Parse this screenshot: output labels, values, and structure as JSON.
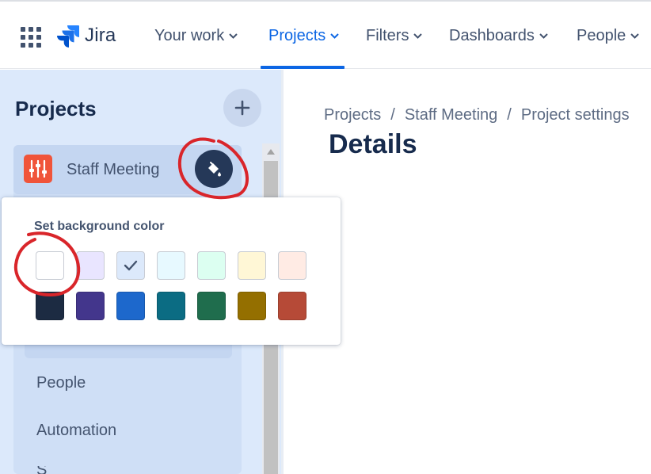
{
  "topnav": {
    "logo_text": "Jira",
    "items": [
      {
        "label": "Your work"
      },
      {
        "label": "Projects"
      },
      {
        "label": "Filters"
      },
      {
        "label": "Dashboards"
      },
      {
        "label": "People"
      }
    ],
    "active_item": "Projects",
    "accent_color": "#0c66e4"
  },
  "sidebar": {
    "title": "Projects",
    "add_icon": "plus-icon",
    "project": {
      "name": "Staff Meeting",
      "avatar_icon": "sliders-icon",
      "avatar_color": "#f0543a"
    },
    "change_bg_icon": "paint-bucket-icon",
    "links": [
      {
        "label": "People"
      },
      {
        "label": "Automation"
      }
    ]
  },
  "main": {
    "breadcrumb": [
      "Projects",
      "Staff Meeting",
      "Project settings"
    ],
    "title": "Details"
  },
  "bg_popup": {
    "title": "Set background color",
    "selected_index": 2,
    "light_colors": [
      "#ffffff",
      "#e9e5ff",
      "#dce9fb",
      "#e7f9ff",
      "#dcfff1",
      "#fff7d6",
      "#ffebe4"
    ],
    "dark_colors": [
      "#1c2b42",
      "#43368c",
      "#1d68cc",
      "#0b6c83",
      "#1f6d4d",
      "#946f00",
      "#b64a37"
    ]
  }
}
